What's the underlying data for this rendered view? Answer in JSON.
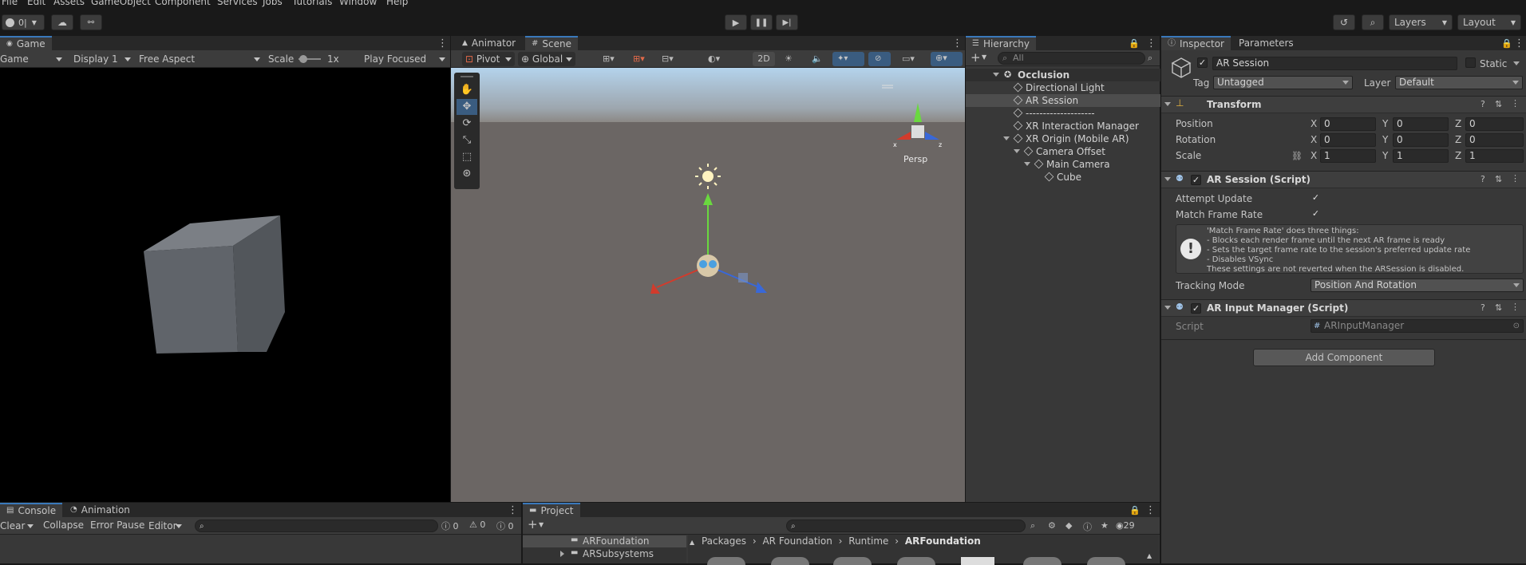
{
  "menu": [
    "File",
    "Edit",
    "Assets",
    "GameObject",
    "Component",
    "Services",
    "Jobs",
    "Tutorials",
    "Window",
    "Help"
  ],
  "toolbar": {
    "account_label": "0|",
    "layers_label": "Layers",
    "layout_label": "Layout"
  },
  "game": {
    "tab": "Game",
    "mode": "Game",
    "display": "Display 1",
    "aspect": "Free Aspect",
    "scale_label": "Scale",
    "scale_value": "1x",
    "play_mode": "Play Focused"
  },
  "scene": {
    "tabs": [
      "Animator",
      "Scene"
    ],
    "pivot": "Pivot",
    "global": "Global",
    "twod": "2D",
    "persp": "Persp"
  },
  "hierarchy": {
    "tab": "Hierarchy",
    "search_placeholder": "All",
    "root": "Occlusion",
    "items": [
      "Directional Light",
      "AR Session",
      "--------------------",
      "XR Interaction Manager",
      "XR Origin (Mobile AR)",
      "Camera Offset",
      "Main Camera",
      "Cube"
    ]
  },
  "inspector": {
    "tabs": [
      "Inspector",
      "Parameters"
    ],
    "object_name": "AR Session",
    "static_label": "Static",
    "tag_label": "Tag",
    "tag_value": "Untagged",
    "layer_label": "Layer",
    "layer_value": "Default",
    "transform": {
      "title": "Transform",
      "position_label": "Position",
      "rotation_label": "Rotation",
      "scale_label": "Scale",
      "position": [
        "0",
        "0",
        "0"
      ],
      "rotation": [
        "0",
        "0",
        "0"
      ],
      "scale": [
        "1",
        "1",
        "1"
      ],
      "axes": [
        "X",
        "Y",
        "Z"
      ]
    },
    "ar_session": {
      "title": "AR Session (Script)",
      "attempt_update_label": "Attempt Update",
      "match_frame_rate_label": "Match Frame Rate",
      "help_lines": [
        "'Match Frame Rate' does three things:",
        "- Blocks each render frame until the next AR frame is ready",
        "- Sets the target frame rate to the session's preferred update rate",
        "- Disables VSync",
        "These settings are not reverted when the ARSession is disabled."
      ],
      "tracking_mode_label": "Tracking Mode",
      "tracking_mode_value": "Position And Rotation"
    },
    "ar_input_manager": {
      "title": "AR Input Manager (Script)",
      "script_label": "Script",
      "script_value": "ARInputManager"
    },
    "add_component": "Add Component"
  },
  "console": {
    "tabs": [
      "Console",
      "Animation"
    ],
    "clear": "Clear",
    "collapse": "Collapse",
    "error_pause": "Error Pause",
    "editor": "Editor",
    "counts": [
      "0",
      "0",
      "0"
    ]
  },
  "project": {
    "tab": "Project",
    "folders": [
      "ARFoundation",
      "ARSubsystems"
    ],
    "breadcrumb": [
      "Packages",
      "AR Foundation",
      "Runtime",
      "ARFoundation"
    ],
    "count": "29"
  }
}
